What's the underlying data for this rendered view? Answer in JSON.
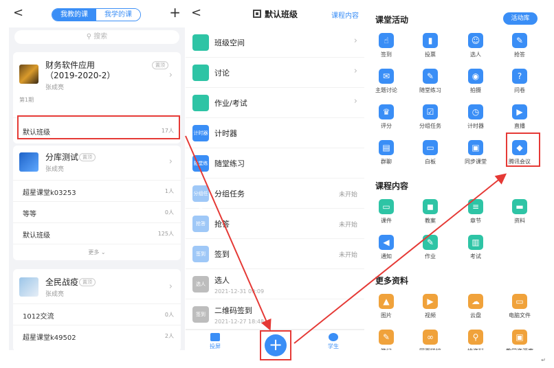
{
  "panel1": {
    "back": "<",
    "segment": {
      "my_teach": "我教的课",
      "my_learn": "我学的课"
    },
    "add": "+",
    "search_placeholder": "搜索",
    "courses": [
      {
        "title_line1": "财务软件应用",
        "title_line2": "（2019-2020-2）",
        "teacher": "张成亮",
        "badge": "置顶",
        "term": "第1期"
      },
      {
        "title_line1": "分库测试",
        "teacher": "张成亮",
        "badge": "置顶"
      },
      {
        "title_line1": "全民战疫",
        "teacher": "张成亮",
        "badge": "置顶"
      }
    ],
    "class_rows": [
      {
        "label": "默认班级",
        "count": "17人"
      },
      {
        "label": "超星课堂k03253",
        "count": "1人"
      },
      {
        "label": "等等",
        "count": "0人"
      },
      {
        "label": "默认班级",
        "count": "125人"
      },
      {
        "label": "1012交流",
        "count": "0人"
      },
      {
        "label": "超星课堂k49502",
        "count": "2人"
      }
    ],
    "more": "更多"
  },
  "panel2": {
    "back": "<",
    "title": "默认班级",
    "link": "课程内容",
    "items": [
      {
        "label": "班级空间",
        "icon_text": "",
        "color": "#2ec4a5"
      },
      {
        "label": "讨论",
        "icon_text": "",
        "color": "#2ec4a5"
      },
      {
        "label": "作业/考试",
        "icon_text": "",
        "color": "#2ec4a5"
      },
      {
        "label": "计时器",
        "icon_text": "计时器",
        "color": "#3a8ef6"
      },
      {
        "label": "随堂练习",
        "icon_text": "随堂练习",
        "color": "#3a8ef6"
      },
      {
        "label": "分组任务",
        "icon_text": "分组任务",
        "color": "#9fc8f7",
        "status": "未开始"
      },
      {
        "label": "抢答",
        "icon_text": "抢答",
        "color": "#9fc8f7",
        "status": "未开始"
      },
      {
        "label": "签到",
        "icon_text": "签到",
        "color": "#9fc8f7",
        "status": "未开始"
      },
      {
        "label": "选人",
        "icon_text": "选人",
        "color": "#bdbdbd",
        "sub": "2021-12-31 09:09"
      },
      {
        "label": "二维码签到",
        "icon_text": "签到",
        "color": "#bdbdbd",
        "sub": "2021-12-27 18:48"
      }
    ],
    "tabs": {
      "screen": "投屏",
      "student": "学生"
    },
    "plus": "+"
  },
  "panel3": {
    "sections": {
      "classroom": "课堂活动",
      "content": "课程内容",
      "more": "更多资料"
    },
    "library": "活动库",
    "activities": [
      "签到",
      "投票",
      "选人",
      "抢答",
      "主题讨论",
      "随堂练习",
      "拍摄",
      "问卷",
      "评分",
      "分组任务",
      "计时器",
      "直播",
      "群聊",
      "白板",
      "同步课堂",
      "腾讯会议"
    ],
    "content": [
      "课件",
      "教案",
      "章节",
      "资料",
      "通知",
      "作业",
      "考试"
    ],
    "more": [
      "图片",
      "视频",
      "云盘",
      "电脑文件",
      "笔记",
      "网页链接",
      "找资料",
      "教学资源库"
    ]
  }
}
